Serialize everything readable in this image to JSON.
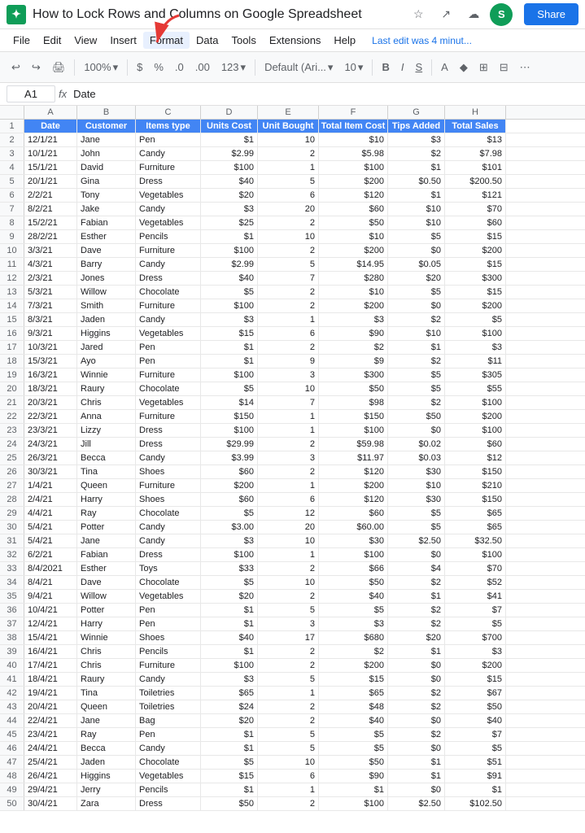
{
  "titleBar": {
    "logo": "G",
    "title": "How to Lock Rows and Columns on Google Spreadsheet",
    "icons": [
      "star",
      "export",
      "save-cloud"
    ],
    "shareButton": "Share",
    "avatarLetter": "S"
  },
  "menuBar": {
    "items": [
      "File",
      "Edit",
      "View",
      "Insert",
      "Format",
      "Data",
      "Tools",
      "Extensions",
      "Help"
    ],
    "lastEdit": "Last edit was 4 minut..."
  },
  "toolbar": {
    "undo": "↩",
    "redo": "↪",
    "print": "🖨",
    "zoom": "100%",
    "zoomArrow": "▾",
    "currency": "$",
    "percent": "%",
    "decimal1": ".0",
    "decimal2": ".00",
    "moreFormats": "123",
    "moreFormatsArrow": "▾",
    "font": "Default (Ari...",
    "fontArrow": "▾",
    "fontSize": "10",
    "fontSizeArrow": "▾",
    "bold": "B",
    "italic": "I",
    "strikethrough": "S",
    "textColor": "A",
    "fillColor": "◆",
    "borders": "⊞",
    "merge": "⊟",
    "more": "⋯"
  },
  "formulaBar": {
    "cellRef": "A1",
    "fxLabel": "fx",
    "formula": "Date"
  },
  "columns": {
    "headers": [
      "A",
      "B",
      "C",
      "D",
      "E",
      "F",
      "G",
      "H"
    ],
    "labels": [
      "Date",
      "Customer",
      "Items type",
      "Units Cost",
      "Unit Bought",
      "Total Item Cost",
      "Tips Added",
      "Total Sales"
    ]
  },
  "rows": [
    [
      "12/1/21",
      "Jane",
      "Pen",
      "$1",
      "10",
      "$10",
      "$3",
      "$13"
    ],
    [
      "10/1/21",
      "John",
      "Candy",
      "$2.99",
      "2",
      "$5.98",
      "$2",
      "$7.98"
    ],
    [
      "15/1/21",
      "David",
      "Furniture",
      "$100",
      "1",
      "$100",
      "$1",
      "$101"
    ],
    [
      "20/1/21",
      "Gina",
      "Dress",
      "$40",
      "5",
      "$200",
      "$0.50",
      "$200.50"
    ],
    [
      "2/2/21",
      "Tony",
      "Vegetables",
      "$20",
      "6",
      "$120",
      "$1",
      "$121"
    ],
    [
      "8/2/21",
      "Jake",
      "Candy",
      "$3",
      "20",
      "$60",
      "$10",
      "$70"
    ],
    [
      "15/2/21",
      "Fabian",
      "Vegetables",
      "$25",
      "2",
      "$50",
      "$10",
      "$60"
    ],
    [
      "28/2/21",
      "Esther",
      "Pencils",
      "$1",
      "10",
      "$10",
      "$5",
      "$15"
    ],
    [
      "3/3/21",
      "Dave",
      "Furniture",
      "$100",
      "2",
      "$200",
      "$0",
      "$200"
    ],
    [
      "4/3/21",
      "Barry",
      "Candy",
      "$2.99",
      "5",
      "$14.95",
      "$0.05",
      "$15"
    ],
    [
      "2/3/21",
      "Jones",
      "Dress",
      "$40",
      "7",
      "$280",
      "$20",
      "$300"
    ],
    [
      "5/3/21",
      "Willow",
      "Chocolate",
      "$5",
      "2",
      "$10",
      "$5",
      "$15"
    ],
    [
      "7/3/21",
      "Smith",
      "Furniture",
      "$100",
      "2",
      "$200",
      "$0",
      "$200"
    ],
    [
      "8/3/21",
      "Jaden",
      "Candy",
      "$3",
      "1",
      "$3",
      "$2",
      "$5"
    ],
    [
      "9/3/21",
      "Higgins",
      "Vegetables",
      "$15",
      "6",
      "$90",
      "$10",
      "$100"
    ],
    [
      "10/3/21",
      "Jared",
      "Pen",
      "$1",
      "2",
      "$2",
      "$1",
      "$3"
    ],
    [
      "15/3/21",
      "Ayo",
      "Pen",
      "$1",
      "9",
      "$9",
      "$2",
      "$11"
    ],
    [
      "16/3/21",
      "Winnie",
      "Furniture",
      "$100",
      "3",
      "$300",
      "$5",
      "$305"
    ],
    [
      "18/3/21",
      "Raury",
      "Chocolate",
      "$5",
      "10",
      "$50",
      "$5",
      "$55"
    ],
    [
      "20/3/21",
      "Chris",
      "Vegetables",
      "$14",
      "7",
      "$98",
      "$2",
      "$100"
    ],
    [
      "22/3/21",
      "Anna",
      "Furniture",
      "$150",
      "1",
      "$150",
      "$50",
      "$200"
    ],
    [
      "23/3/21",
      "Lizzy",
      "Dress",
      "$100",
      "1",
      "$100",
      "$0",
      "$100"
    ],
    [
      "24/3/21",
      "Jill",
      "Dress",
      "$29.99",
      "2",
      "$59.98",
      "$0.02",
      "$60"
    ],
    [
      "26/3/21",
      "Becca",
      "Candy",
      "$3.99",
      "3",
      "$11.97",
      "$0.03",
      "$12"
    ],
    [
      "30/3/21",
      "Tina",
      "Shoes",
      "$60",
      "2",
      "$120",
      "$30",
      "$150"
    ],
    [
      "1/4/21",
      "Queen",
      "Furniture",
      "$200",
      "1",
      "$200",
      "$10",
      "$210"
    ],
    [
      "2/4/21",
      "Harry",
      "Shoes",
      "$60",
      "6",
      "$120",
      "$30",
      "$150"
    ],
    [
      "4/4/21",
      "Ray",
      "Chocolate",
      "$5",
      "12",
      "$60",
      "$5",
      "$65"
    ],
    [
      "5/4/21",
      "Potter",
      "Candy",
      "$3.00",
      "20",
      "$60.00",
      "$5",
      "$65"
    ],
    [
      "5/4/21",
      "Jane",
      "Candy",
      "$3",
      "10",
      "$30",
      "$2.50",
      "$32.50"
    ],
    [
      "6/2/21",
      "Fabian",
      "Dress",
      "$100",
      "1",
      "$100",
      "$0",
      "$100"
    ],
    [
      "8/4/2021",
      "Esther",
      "Toys",
      "$33",
      "2",
      "$66",
      "$4",
      "$70"
    ],
    [
      "8/4/21",
      "Dave",
      "Chocolate",
      "$5",
      "10",
      "$50",
      "$2",
      "$52"
    ],
    [
      "9/4/21",
      "Willow",
      "Vegetables",
      "$20",
      "2",
      "$40",
      "$1",
      "$41"
    ],
    [
      "10/4/21",
      "Potter",
      "Pen",
      "$1",
      "5",
      "$5",
      "$2",
      "$7"
    ],
    [
      "12/4/21",
      "Harry",
      "Pen",
      "$1",
      "3",
      "$3",
      "$2",
      "$5"
    ],
    [
      "15/4/21",
      "Winnie",
      "Shoes",
      "$40",
      "17",
      "$680",
      "$20",
      "$700"
    ],
    [
      "16/4/21",
      "Chris",
      "Pencils",
      "$1",
      "2",
      "$2",
      "$1",
      "$3"
    ],
    [
      "17/4/21",
      "Chris",
      "Furniture",
      "$100",
      "2",
      "$200",
      "$0",
      "$200"
    ],
    [
      "18/4/21",
      "Raury",
      "Candy",
      "$3",
      "5",
      "$15",
      "$0",
      "$15"
    ],
    [
      "19/4/21",
      "Tina",
      "Toiletries",
      "$65",
      "1",
      "$65",
      "$2",
      "$67"
    ],
    [
      "20/4/21",
      "Queen",
      "Toiletries",
      "$24",
      "2",
      "$48",
      "$2",
      "$50"
    ],
    [
      "22/4/21",
      "Jane",
      "Bag",
      "$20",
      "2",
      "$40",
      "$0",
      "$40"
    ],
    [
      "23/4/21",
      "Ray",
      "Pen",
      "$1",
      "5",
      "$5",
      "$2",
      "$7"
    ],
    [
      "24/4/21",
      "Becca",
      "Candy",
      "$1",
      "5",
      "$5",
      "$0",
      "$5"
    ],
    [
      "25/4/21",
      "Jaden",
      "Chocolate",
      "$5",
      "10",
      "$50",
      "$1",
      "$51"
    ],
    [
      "26/4/21",
      "Higgins",
      "Vegetables",
      "$15",
      "6",
      "$90",
      "$1",
      "$91"
    ],
    [
      "29/4/21",
      "Jerry",
      "Pencils",
      "$1",
      "1",
      "$1",
      "$0",
      "$1"
    ],
    [
      "30/4/21",
      "Zara",
      "Dress",
      "$50",
      "2",
      "$100",
      "$2.50",
      "$102.50"
    ]
  ]
}
